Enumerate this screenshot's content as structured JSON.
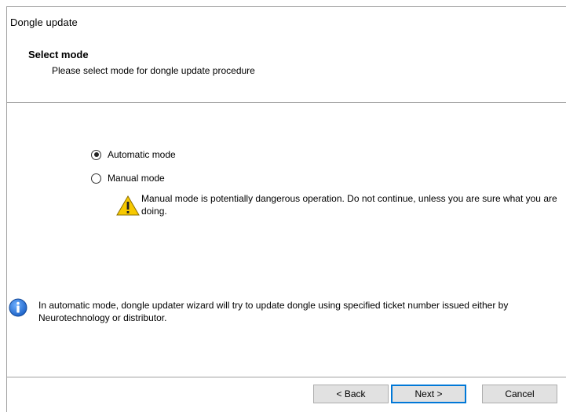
{
  "window": {
    "title": "Dongle update"
  },
  "header": {
    "title": "Select mode",
    "subtitle": "Please select mode for dongle update procedure"
  },
  "modes": {
    "automatic": {
      "label": "Automatic mode",
      "selected": true
    },
    "manual": {
      "label": "Manual mode",
      "selected": false
    }
  },
  "warning": {
    "icon": "warning-icon",
    "text": "Manual mode is potentially dangerous operation. Do not continue, unless you are sure what you are doing."
  },
  "info": {
    "icon": "info-icon",
    "text": "In automatic mode, dongle updater wizard will try to update dongle using specified ticket number issued either by Neurotechnology or distributor."
  },
  "buttons": {
    "back": "< Back",
    "next": "Next >",
    "cancel": "Cancel"
  },
  "colors": {
    "accent": "#0078d7",
    "warning_yellow": "#f7c900",
    "info_blue": "#1e64c8"
  }
}
